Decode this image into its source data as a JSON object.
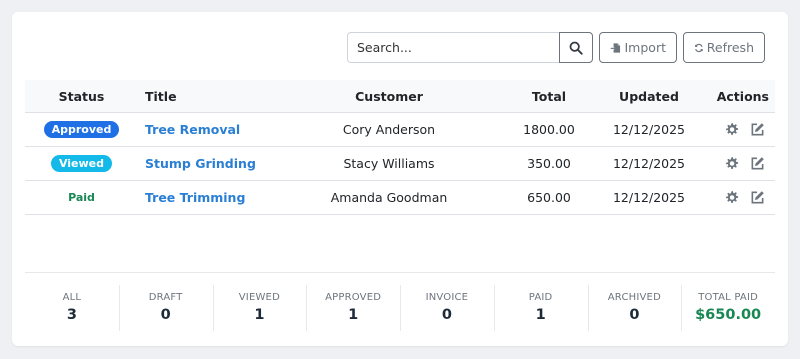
{
  "toolbar": {
    "search_placeholder": "Search...",
    "search_value": "",
    "import_label": "Import",
    "refresh_label": "Refresh"
  },
  "table": {
    "headers": {
      "status": "Status",
      "title": "Title",
      "customer": "Customer",
      "total": "Total",
      "updated": "Updated",
      "actions": "Actions"
    },
    "rows": [
      {
        "status": "Approved",
        "status_color": "#1f6fe5",
        "title": "Tree Removal",
        "customer": "Cory Anderson",
        "total": "1800.00",
        "updated": "12/12/2025"
      },
      {
        "status": "Viewed",
        "status_color": "#13b9e8",
        "title": "Stump Grinding",
        "customer": "Stacy Williams",
        "total": "350.00",
        "updated": "12/12/2025"
      },
      {
        "status": "Paid",
        "status_color": "#198754",
        "title": "Tree Trimming",
        "customer": "Amanda Goodman",
        "total": "650.00",
        "updated": "12/12/2025"
      }
    ],
    "action_icons": [
      "gear-icon",
      "edit-icon"
    ]
  },
  "summary": [
    {
      "label": "ALL",
      "value": "3"
    },
    {
      "label": "DRAFT",
      "value": "0"
    },
    {
      "label": "VIEWED",
      "value": "1"
    },
    {
      "label": "APPROVED",
      "value": "1"
    },
    {
      "label": "INVOICE",
      "value": "0"
    },
    {
      "label": "PAID",
      "value": "1"
    },
    {
      "label": "ARCHIVED",
      "value": "0"
    },
    {
      "label": "TOTAL PAID",
      "value": "$650.00"
    }
  ],
  "colors": {
    "link": "#2a7fd4",
    "paid_green": "#198754",
    "button_gray": "#6c757d"
  }
}
